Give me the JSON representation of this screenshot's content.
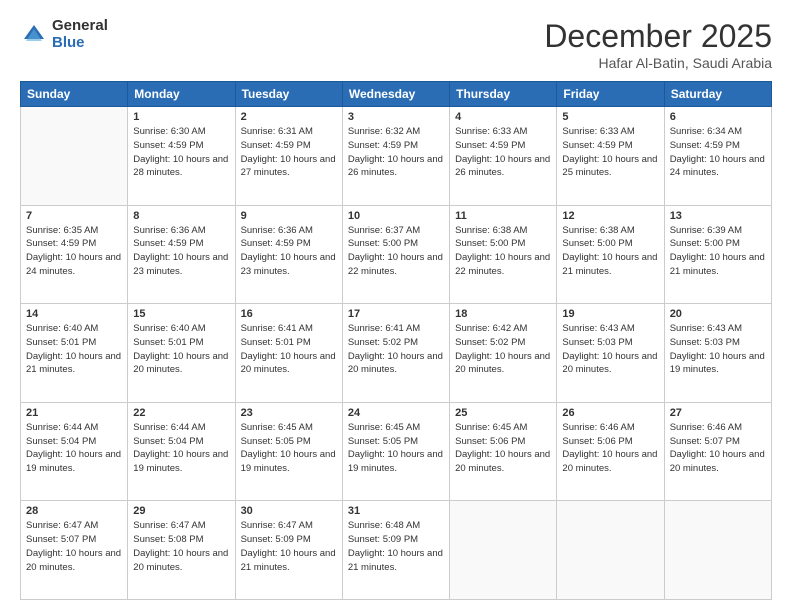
{
  "logo": {
    "general": "General",
    "blue": "Blue"
  },
  "header": {
    "title": "December 2025",
    "subtitle": "Hafar Al-Batin, Saudi Arabia"
  },
  "days": [
    "Sunday",
    "Monday",
    "Tuesday",
    "Wednesday",
    "Thursday",
    "Friday",
    "Saturday"
  ],
  "weeks": [
    [
      {
        "date": "",
        "sunrise": "",
        "sunset": "",
        "daylight": ""
      },
      {
        "date": "1",
        "sunrise": "Sunrise: 6:30 AM",
        "sunset": "Sunset: 4:59 PM",
        "daylight": "Daylight: 10 hours and 28 minutes."
      },
      {
        "date": "2",
        "sunrise": "Sunrise: 6:31 AM",
        "sunset": "Sunset: 4:59 PM",
        "daylight": "Daylight: 10 hours and 27 minutes."
      },
      {
        "date": "3",
        "sunrise": "Sunrise: 6:32 AM",
        "sunset": "Sunset: 4:59 PM",
        "daylight": "Daylight: 10 hours and 26 minutes."
      },
      {
        "date": "4",
        "sunrise": "Sunrise: 6:33 AM",
        "sunset": "Sunset: 4:59 PM",
        "daylight": "Daylight: 10 hours and 26 minutes."
      },
      {
        "date": "5",
        "sunrise": "Sunrise: 6:33 AM",
        "sunset": "Sunset: 4:59 PM",
        "daylight": "Daylight: 10 hours and 25 minutes."
      },
      {
        "date": "6",
        "sunrise": "Sunrise: 6:34 AM",
        "sunset": "Sunset: 4:59 PM",
        "daylight": "Daylight: 10 hours and 24 minutes."
      }
    ],
    [
      {
        "date": "7",
        "sunrise": "Sunrise: 6:35 AM",
        "sunset": "Sunset: 4:59 PM",
        "daylight": "Daylight: 10 hours and 24 minutes."
      },
      {
        "date": "8",
        "sunrise": "Sunrise: 6:36 AM",
        "sunset": "Sunset: 4:59 PM",
        "daylight": "Daylight: 10 hours and 23 minutes."
      },
      {
        "date": "9",
        "sunrise": "Sunrise: 6:36 AM",
        "sunset": "Sunset: 4:59 PM",
        "daylight": "Daylight: 10 hours and 23 minutes."
      },
      {
        "date": "10",
        "sunrise": "Sunrise: 6:37 AM",
        "sunset": "Sunset: 5:00 PM",
        "daylight": "Daylight: 10 hours and 22 minutes."
      },
      {
        "date": "11",
        "sunrise": "Sunrise: 6:38 AM",
        "sunset": "Sunset: 5:00 PM",
        "daylight": "Daylight: 10 hours and 22 minutes."
      },
      {
        "date": "12",
        "sunrise": "Sunrise: 6:38 AM",
        "sunset": "Sunset: 5:00 PM",
        "daylight": "Daylight: 10 hours and 21 minutes."
      },
      {
        "date": "13",
        "sunrise": "Sunrise: 6:39 AM",
        "sunset": "Sunset: 5:00 PM",
        "daylight": "Daylight: 10 hours and 21 minutes."
      }
    ],
    [
      {
        "date": "14",
        "sunrise": "Sunrise: 6:40 AM",
        "sunset": "Sunset: 5:01 PM",
        "daylight": "Daylight: 10 hours and 21 minutes."
      },
      {
        "date": "15",
        "sunrise": "Sunrise: 6:40 AM",
        "sunset": "Sunset: 5:01 PM",
        "daylight": "Daylight: 10 hours and 20 minutes."
      },
      {
        "date": "16",
        "sunrise": "Sunrise: 6:41 AM",
        "sunset": "Sunset: 5:01 PM",
        "daylight": "Daylight: 10 hours and 20 minutes."
      },
      {
        "date": "17",
        "sunrise": "Sunrise: 6:41 AM",
        "sunset": "Sunset: 5:02 PM",
        "daylight": "Daylight: 10 hours and 20 minutes."
      },
      {
        "date": "18",
        "sunrise": "Sunrise: 6:42 AM",
        "sunset": "Sunset: 5:02 PM",
        "daylight": "Daylight: 10 hours and 20 minutes."
      },
      {
        "date": "19",
        "sunrise": "Sunrise: 6:43 AM",
        "sunset": "Sunset: 5:03 PM",
        "daylight": "Daylight: 10 hours and 20 minutes."
      },
      {
        "date": "20",
        "sunrise": "Sunrise: 6:43 AM",
        "sunset": "Sunset: 5:03 PM",
        "daylight": "Daylight: 10 hours and 19 minutes."
      }
    ],
    [
      {
        "date": "21",
        "sunrise": "Sunrise: 6:44 AM",
        "sunset": "Sunset: 5:04 PM",
        "daylight": "Daylight: 10 hours and 19 minutes."
      },
      {
        "date": "22",
        "sunrise": "Sunrise: 6:44 AM",
        "sunset": "Sunset: 5:04 PM",
        "daylight": "Daylight: 10 hours and 19 minutes."
      },
      {
        "date": "23",
        "sunrise": "Sunrise: 6:45 AM",
        "sunset": "Sunset: 5:05 PM",
        "daylight": "Daylight: 10 hours and 19 minutes."
      },
      {
        "date": "24",
        "sunrise": "Sunrise: 6:45 AM",
        "sunset": "Sunset: 5:05 PM",
        "daylight": "Daylight: 10 hours and 19 minutes."
      },
      {
        "date": "25",
        "sunrise": "Sunrise: 6:45 AM",
        "sunset": "Sunset: 5:06 PM",
        "daylight": "Daylight: 10 hours and 20 minutes."
      },
      {
        "date": "26",
        "sunrise": "Sunrise: 6:46 AM",
        "sunset": "Sunset: 5:06 PM",
        "daylight": "Daylight: 10 hours and 20 minutes."
      },
      {
        "date": "27",
        "sunrise": "Sunrise: 6:46 AM",
        "sunset": "Sunset: 5:07 PM",
        "daylight": "Daylight: 10 hours and 20 minutes."
      }
    ],
    [
      {
        "date": "28",
        "sunrise": "Sunrise: 6:47 AM",
        "sunset": "Sunset: 5:07 PM",
        "daylight": "Daylight: 10 hours and 20 minutes."
      },
      {
        "date": "29",
        "sunrise": "Sunrise: 6:47 AM",
        "sunset": "Sunset: 5:08 PM",
        "daylight": "Daylight: 10 hours and 20 minutes."
      },
      {
        "date": "30",
        "sunrise": "Sunrise: 6:47 AM",
        "sunset": "Sunset: 5:09 PM",
        "daylight": "Daylight: 10 hours and 21 minutes."
      },
      {
        "date": "31",
        "sunrise": "Sunrise: 6:48 AM",
        "sunset": "Sunset: 5:09 PM",
        "daylight": "Daylight: 10 hours and 21 minutes."
      },
      {
        "date": "",
        "sunrise": "",
        "sunset": "",
        "daylight": ""
      },
      {
        "date": "",
        "sunrise": "",
        "sunset": "",
        "daylight": ""
      },
      {
        "date": "",
        "sunrise": "",
        "sunset": "",
        "daylight": ""
      }
    ]
  ]
}
